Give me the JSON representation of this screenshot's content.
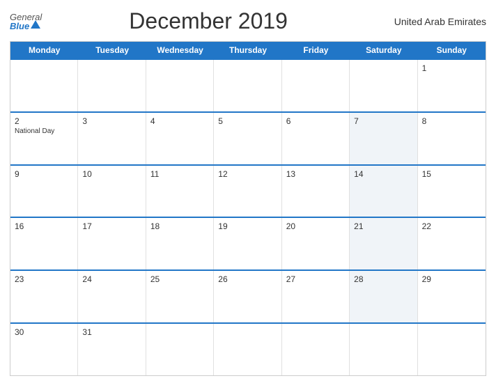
{
  "header": {
    "logo_general": "General",
    "logo_blue": "Blue",
    "title": "December 2019",
    "country": "United Arab Emirates"
  },
  "calendar": {
    "weekdays": [
      "Monday",
      "Tuesday",
      "Wednesday",
      "Thursday",
      "Friday",
      "Saturday",
      "Sunday"
    ],
    "weeks": [
      [
        {
          "day": "",
          "event": "",
          "shaded": false
        },
        {
          "day": "",
          "event": "",
          "shaded": false
        },
        {
          "day": "",
          "event": "",
          "shaded": false
        },
        {
          "day": "",
          "event": "",
          "shaded": false
        },
        {
          "day": "",
          "event": "",
          "shaded": false
        },
        {
          "day": "",
          "event": "",
          "shaded": true
        },
        {
          "day": "1",
          "event": "",
          "shaded": false
        }
      ],
      [
        {
          "day": "2",
          "event": "National Day",
          "shaded": false
        },
        {
          "day": "3",
          "event": "",
          "shaded": false
        },
        {
          "day": "4",
          "event": "",
          "shaded": false
        },
        {
          "day": "5",
          "event": "",
          "shaded": false
        },
        {
          "day": "6",
          "event": "",
          "shaded": false
        },
        {
          "day": "7",
          "event": "",
          "shaded": true
        },
        {
          "day": "8",
          "event": "",
          "shaded": false
        }
      ],
      [
        {
          "day": "9",
          "event": "",
          "shaded": false
        },
        {
          "day": "10",
          "event": "",
          "shaded": false
        },
        {
          "day": "11",
          "event": "",
          "shaded": false
        },
        {
          "day": "12",
          "event": "",
          "shaded": false
        },
        {
          "day": "13",
          "event": "",
          "shaded": false
        },
        {
          "day": "14",
          "event": "",
          "shaded": true
        },
        {
          "day": "15",
          "event": "",
          "shaded": false
        }
      ],
      [
        {
          "day": "16",
          "event": "",
          "shaded": false
        },
        {
          "day": "17",
          "event": "",
          "shaded": false
        },
        {
          "day": "18",
          "event": "",
          "shaded": false
        },
        {
          "day": "19",
          "event": "",
          "shaded": false
        },
        {
          "day": "20",
          "event": "",
          "shaded": false
        },
        {
          "day": "21",
          "event": "",
          "shaded": true
        },
        {
          "day": "22",
          "event": "",
          "shaded": false
        }
      ],
      [
        {
          "day": "23",
          "event": "",
          "shaded": false
        },
        {
          "day": "24",
          "event": "",
          "shaded": false
        },
        {
          "day": "25",
          "event": "",
          "shaded": false
        },
        {
          "day": "26",
          "event": "",
          "shaded": false
        },
        {
          "day": "27",
          "event": "",
          "shaded": false
        },
        {
          "day": "28",
          "event": "",
          "shaded": true
        },
        {
          "day": "29",
          "event": "",
          "shaded": false
        }
      ],
      [
        {
          "day": "30",
          "event": "",
          "shaded": false
        },
        {
          "day": "31",
          "event": "",
          "shaded": false
        },
        {
          "day": "",
          "event": "",
          "shaded": false
        },
        {
          "day": "",
          "event": "",
          "shaded": false
        },
        {
          "day": "",
          "event": "",
          "shaded": false
        },
        {
          "day": "",
          "event": "",
          "shaded": true
        },
        {
          "day": "",
          "event": "",
          "shaded": false
        }
      ]
    ]
  }
}
